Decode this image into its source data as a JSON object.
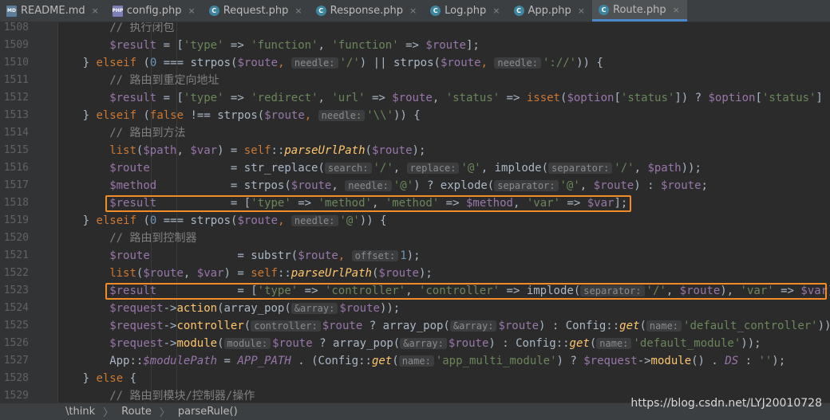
{
  "tabs": [
    {
      "label": "README.md",
      "icon": "markdown-file-icon",
      "active": false
    },
    {
      "label": "config.php",
      "icon": "php-file-icon",
      "active": false
    },
    {
      "label": "Request.php",
      "icon": "php-class-icon",
      "active": false
    },
    {
      "label": "Response.php",
      "icon": "php-class-icon",
      "active": false
    },
    {
      "label": "Log.php",
      "icon": "php-class-icon",
      "active": false
    },
    {
      "label": "App.php",
      "icon": "php-class-icon",
      "active": false
    },
    {
      "label": "Route.php",
      "icon": "php-class-icon",
      "active": true
    }
  ],
  "tab_close_glyph": "×",
  "breadcrumb": [
    "\\think",
    "Route",
    "parseRule()"
  ],
  "breadcrumb_sep": "〉",
  "watermark": "https://blog.csdn.net/LYJ20010728",
  "highlight_color": "#f28c28",
  "lines": [
    {
      "num": "1508",
      "indent": 8,
      "tokens": [
        [
          "cmt",
          "// 执行闭包"
        ]
      ]
    },
    {
      "num": "1509",
      "indent": 8,
      "tokens": [
        [
          "var",
          "$result"
        ],
        [
          "p",
          " = ["
        ],
        [
          "str",
          "'type'"
        ],
        [
          "p",
          " => "
        ],
        [
          "str",
          "'function'"
        ],
        [
          "p",
          ", "
        ],
        [
          "str",
          "'function'"
        ],
        [
          "p",
          " => "
        ],
        [
          "var",
          "$route"
        ],
        [
          "p",
          "];"
        ]
      ]
    },
    {
      "num": "1510",
      "indent": 4,
      "tokens": [
        [
          "p",
          "} "
        ],
        [
          "kw",
          "elseif"
        ],
        [
          "p",
          " ("
        ],
        [
          "num",
          "0"
        ],
        [
          "p",
          " === strpos("
        ],
        [
          "var",
          "$route"
        ],
        [
          "kw",
          ", "
        ],
        [
          "hint",
          "needle:"
        ],
        [
          "str",
          "'/'"
        ],
        [
          "p",
          ") || strpos("
        ],
        [
          "var",
          "$route"
        ],
        [
          "kw",
          ", "
        ],
        [
          "hint",
          "needle:"
        ],
        [
          "str",
          "'://'"
        ],
        [
          "p",
          ")) {"
        ]
      ]
    },
    {
      "num": "1511",
      "indent": 8,
      "tokens": [
        [
          "cmt",
          "// 路由到重定向地址"
        ]
      ]
    },
    {
      "num": "1512",
      "indent": 8,
      "tokens": [
        [
          "var",
          "$result"
        ],
        [
          "p",
          " = ["
        ],
        [
          "str",
          "'type'"
        ],
        [
          "p",
          " => "
        ],
        [
          "str",
          "'redirect'"
        ],
        [
          "p",
          ", "
        ],
        [
          "str",
          "'url'"
        ],
        [
          "p",
          " => "
        ],
        [
          "var",
          "$route"
        ],
        [
          "p",
          ", "
        ],
        [
          "str",
          "'status'"
        ],
        [
          "p",
          " => "
        ],
        [
          "kw",
          "isset"
        ],
        [
          "p",
          "("
        ],
        [
          "var",
          "$option"
        ],
        [
          "p",
          "["
        ],
        [
          "str",
          "'status'"
        ],
        [
          "p",
          "]) ? "
        ],
        [
          "var",
          "$option"
        ],
        [
          "p",
          "["
        ],
        [
          "str",
          "'status'"
        ],
        [
          "p",
          "] :"
        ]
      ]
    },
    {
      "num": "1513",
      "indent": 4,
      "tokens": [
        [
          "p",
          "} "
        ],
        [
          "kw",
          "elseif"
        ],
        [
          "p",
          " ("
        ],
        [
          "kw",
          "false"
        ],
        [
          "p",
          " !== strpos("
        ],
        [
          "var",
          "$route"
        ],
        [
          "kw",
          ", "
        ],
        [
          "hint",
          "needle:"
        ],
        [
          "str",
          "'\\\\'"
        ],
        [
          "p",
          ")) {"
        ]
      ]
    },
    {
      "num": "1514",
      "indent": 8,
      "tokens": [
        [
          "cmt",
          "// 路由到方法"
        ]
      ]
    },
    {
      "num": "1515",
      "indent": 8,
      "tokens": [
        [
          "kw",
          "list"
        ],
        [
          "p",
          "("
        ],
        [
          "var",
          "$path"
        ],
        [
          "p",
          ", "
        ],
        [
          "var",
          "$var"
        ],
        [
          "p",
          ") = "
        ],
        [
          "kw",
          "self"
        ],
        [
          "p",
          "::"
        ],
        [
          "ital",
          "parseUrlPath"
        ],
        [
          "p",
          "("
        ],
        [
          "var",
          "$route"
        ],
        [
          "p",
          ");"
        ]
      ]
    },
    {
      "num": "1516",
      "indent": 8,
      "tokens": [
        [
          "var",
          "$route"
        ],
        [
          "p",
          "            = str_replace("
        ],
        [
          "hint",
          "search:"
        ],
        [
          "str",
          "'/'"
        ],
        [
          "p",
          ", "
        ],
        [
          "hint",
          "replace:"
        ],
        [
          "str",
          "'@'"
        ],
        [
          "p",
          ", implode("
        ],
        [
          "hint",
          "separator:"
        ],
        [
          "str",
          "'/'"
        ],
        [
          "p",
          ", "
        ],
        [
          "var",
          "$path"
        ],
        [
          "p",
          "));"
        ]
      ]
    },
    {
      "num": "1517",
      "indent": 8,
      "tokens": [
        [
          "var",
          "$method"
        ],
        [
          "p",
          "           = strpos("
        ],
        [
          "var",
          "$route"
        ],
        [
          "p",
          ", "
        ],
        [
          "hint",
          "needle:"
        ],
        [
          "str",
          "'@'"
        ],
        [
          "p",
          ") ? explode("
        ],
        [
          "hint",
          "separator:"
        ],
        [
          "str",
          "'@'"
        ],
        [
          "p",
          ", "
        ],
        [
          "var",
          "$route"
        ],
        [
          "p",
          ") : "
        ],
        [
          "var",
          "$route"
        ],
        [
          "p",
          ";"
        ]
      ]
    },
    {
      "num": "1518",
      "indent": 8,
      "tokens": [
        [
          "var",
          "$result"
        ],
        [
          "p",
          "           = ["
        ],
        [
          "str",
          "'type'"
        ],
        [
          "p",
          " => "
        ],
        [
          "str",
          "'method'"
        ],
        [
          "p",
          ", "
        ],
        [
          "str",
          "'method'"
        ],
        [
          "p",
          " => "
        ],
        [
          "var",
          "$method"
        ],
        [
          "p",
          ", "
        ],
        [
          "str",
          "'var'"
        ],
        [
          "p",
          " => "
        ],
        [
          "var",
          "$var"
        ],
        [
          "p",
          "];"
        ]
      ]
    },
    {
      "num": "1519",
      "indent": 4,
      "tokens": [
        [
          "p",
          "} "
        ],
        [
          "kw",
          "elseif"
        ],
        [
          "p",
          " ("
        ],
        [
          "num",
          "0"
        ],
        [
          "p",
          " === strpos("
        ],
        [
          "var",
          "$route"
        ],
        [
          "kw",
          ", "
        ],
        [
          "hint",
          "needle:"
        ],
        [
          "str",
          "'@'"
        ],
        [
          "p",
          ")) {"
        ]
      ]
    },
    {
      "num": "1520",
      "indent": 8,
      "tokens": [
        [
          "cmt",
          "// 路由到控制器"
        ]
      ]
    },
    {
      "num": "1521",
      "indent": 8,
      "tokens": [
        [
          "var",
          "$route"
        ],
        [
          "p",
          "             = substr("
        ],
        [
          "var",
          "$route"
        ],
        [
          "kw",
          ", "
        ],
        [
          "hint",
          "offset:"
        ],
        [
          "num",
          "1"
        ],
        [
          "p",
          ");"
        ]
      ]
    },
    {
      "num": "1522",
      "indent": 8,
      "tokens": [
        [
          "kw",
          "list"
        ],
        [
          "p",
          "("
        ],
        [
          "var",
          "$route"
        ],
        [
          "p",
          ", "
        ],
        [
          "var",
          "$var"
        ],
        [
          "p",
          ") = "
        ],
        [
          "kw",
          "self"
        ],
        [
          "p",
          "::"
        ],
        [
          "ital",
          "parseUrlPath"
        ],
        [
          "p",
          "("
        ],
        [
          "var",
          "$route"
        ],
        [
          "p",
          ");"
        ]
      ]
    },
    {
      "num": "1523",
      "indent": 8,
      "tokens": [
        [
          "var",
          "$result"
        ],
        [
          "p",
          "            = ["
        ],
        [
          "str",
          "'type'"
        ],
        [
          "p",
          " => "
        ],
        [
          "str",
          "'controller'"
        ],
        [
          "p",
          ", "
        ],
        [
          "str",
          "'controller'"
        ],
        [
          "p",
          " => implode("
        ],
        [
          "hint",
          "separator:"
        ],
        [
          "str",
          "'/'"
        ],
        [
          "p",
          ", "
        ],
        [
          "var",
          "$route"
        ],
        [
          "p",
          "), "
        ],
        [
          "str",
          "'var'"
        ],
        [
          "p",
          " => "
        ],
        [
          "var",
          "$var"
        ],
        [
          "p",
          "]"
        ]
      ]
    },
    {
      "num": "1524",
      "indent": 8,
      "tokens": [
        [
          "var",
          "$request"
        ],
        [
          "p",
          "->"
        ],
        [
          "fn",
          "action"
        ],
        [
          "p",
          "(array_pop("
        ],
        [
          "hint",
          "&array:"
        ],
        [
          "var",
          "$route"
        ],
        [
          "p",
          "));"
        ]
      ]
    },
    {
      "num": "1525",
      "indent": 8,
      "tokens": [
        [
          "var",
          "$request"
        ],
        [
          "p",
          "->"
        ],
        [
          "fn",
          "controller"
        ],
        [
          "p",
          "("
        ],
        [
          "hint",
          "controller:"
        ],
        [
          "var",
          "$route"
        ],
        [
          "p",
          " ? array_pop("
        ],
        [
          "hint",
          "&array:"
        ],
        [
          "var",
          "$route"
        ],
        [
          "p",
          ") : Config::"
        ],
        [
          "ital",
          "get"
        ],
        [
          "p",
          "("
        ],
        [
          "hint",
          "name:"
        ],
        [
          "str",
          "'default_controller'"
        ],
        [
          "p",
          "));"
        ]
      ]
    },
    {
      "num": "1526",
      "indent": 8,
      "tokens": [
        [
          "var",
          "$request"
        ],
        [
          "p",
          "->"
        ],
        [
          "fn",
          "module"
        ],
        [
          "p",
          "("
        ],
        [
          "hint",
          "module:"
        ],
        [
          "var",
          "$route"
        ],
        [
          "p",
          " ? array_pop("
        ],
        [
          "hint",
          "&array:"
        ],
        [
          "var",
          "$route"
        ],
        [
          "p",
          ") : Config::"
        ],
        [
          "ital",
          "get"
        ],
        [
          "p",
          "("
        ],
        [
          "hint",
          "name:"
        ],
        [
          "str",
          "'default_module'"
        ],
        [
          "p",
          "));"
        ]
      ]
    },
    {
      "num": "1527",
      "indent": 8,
      "tokens": [
        [
          "p",
          "App::"
        ],
        [
          "ivar",
          "$modulePath"
        ],
        [
          "p",
          " = "
        ],
        [
          "const",
          "APP_PATH"
        ],
        [
          "p",
          " . (Config::"
        ],
        [
          "ital",
          "get"
        ],
        [
          "p",
          "("
        ],
        [
          "hint",
          "name:"
        ],
        [
          "str",
          "'app_multi_module'"
        ],
        [
          "p",
          ") ? "
        ],
        [
          "var",
          "$request"
        ],
        [
          "p",
          "->"
        ],
        [
          "fn",
          "module"
        ],
        [
          "p",
          "() . "
        ],
        [
          "const",
          "DS"
        ],
        [
          "p",
          " : "
        ],
        [
          "str",
          "''"
        ],
        [
          "p",
          ");"
        ]
      ]
    },
    {
      "num": "1528",
      "indent": 4,
      "tokens": [
        [
          "p",
          "} "
        ],
        [
          "kw",
          "else"
        ],
        [
          "p",
          " {"
        ]
      ]
    },
    {
      "num": "1529",
      "indent": 8,
      "tokens": [
        [
          "cmt",
          "// 路由到模块/控制器/操作"
        ]
      ]
    }
  ]
}
